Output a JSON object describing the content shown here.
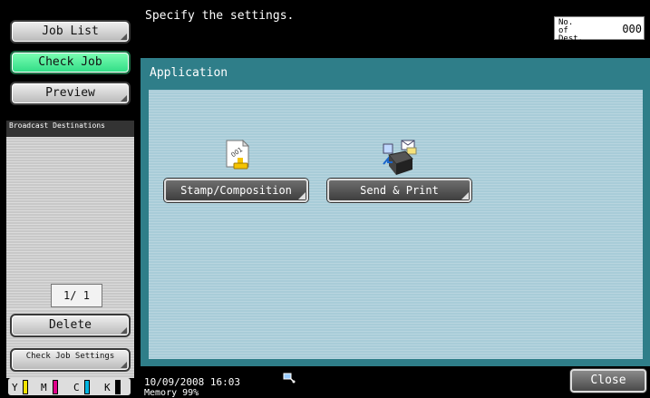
{
  "left_panel": {
    "job_list": "Job List",
    "check_job": "Check Job",
    "preview": "Preview",
    "broadcast_header": "Broadcast Destinations",
    "page_indicator": "1/ 1",
    "delete": "Delete",
    "check_job_settings": "Check Job Settings",
    "toner": [
      {
        "letter": "Y",
        "color": "#f2e200"
      },
      {
        "letter": "M",
        "color": "#e0008a"
      },
      {
        "letter": "C",
        "color": "#00b4e0"
      },
      {
        "letter": "K",
        "color": "#000000"
      }
    ]
  },
  "header": {
    "message": "Specify the settings.",
    "dest_label": "No. of Dest.",
    "dest_count": "000"
  },
  "application": {
    "title": "Application",
    "buttons": [
      {
        "label": "Stamp/Composition",
        "icon": "stamp-composition-icon"
      },
      {
        "label": "Send & Print",
        "icon": "send-print-icon"
      }
    ]
  },
  "footer": {
    "datetime": "10/09/2008   16:03",
    "memory": "Memory      99%",
    "close": "Close"
  },
  "colors": {
    "panel_teal": "#2f7e89",
    "panel_light": "#a8ccd8",
    "check_job_green": "#2fdc85"
  }
}
